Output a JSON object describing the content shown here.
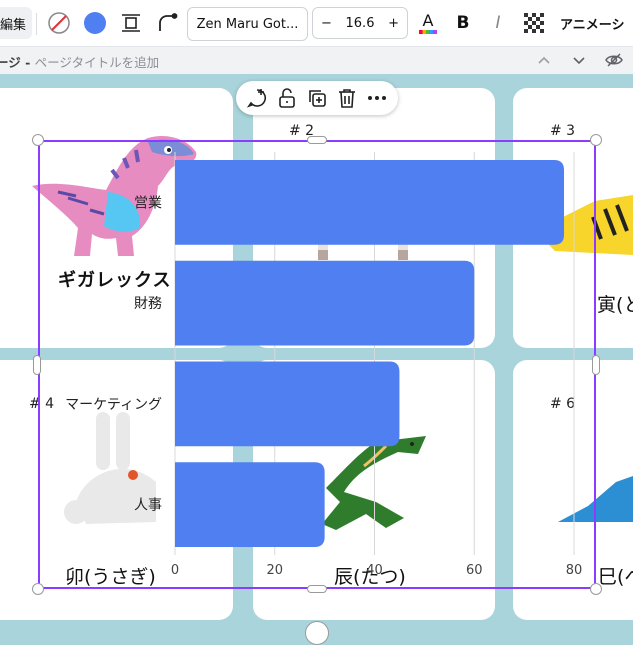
{
  "toolbar": {
    "edit_label": "編集",
    "font_name": "Zen Maru Got...",
    "font_size": "16.6",
    "minus": "−",
    "plus": "+",
    "bold": "B",
    "italic": "I",
    "animate_label": "アニメーシ",
    "fill_color": "#4f7ff0"
  },
  "pagebar": {
    "prefix": "ージ - ",
    "title_placeholder": "ページタイトルを追加"
  },
  "cards": {
    "c2_num": "# 2",
    "c3_num": "# 3",
    "c4_num": "# 4",
    "c6_num": "# 6",
    "c3_label": "寅(と",
    "c4_label": "卯(うさぎ)",
    "c5_label": "辰(たつ)",
    "c6_label": "巳(へ",
    "dino_name": "ギガレックス"
  },
  "chart_data": {
    "type": "bar",
    "orientation": "horizontal",
    "categories": [
      "営業",
      "財務",
      "マーケティング",
      "人事"
    ],
    "values": [
      78,
      60,
      45,
      30
    ],
    "xlim": [
      0,
      80
    ],
    "xticks": [
      "0",
      "20",
      "40",
      "60",
      "80"
    ],
    "grid": true,
    "bar_color": "#4f7ff0"
  }
}
